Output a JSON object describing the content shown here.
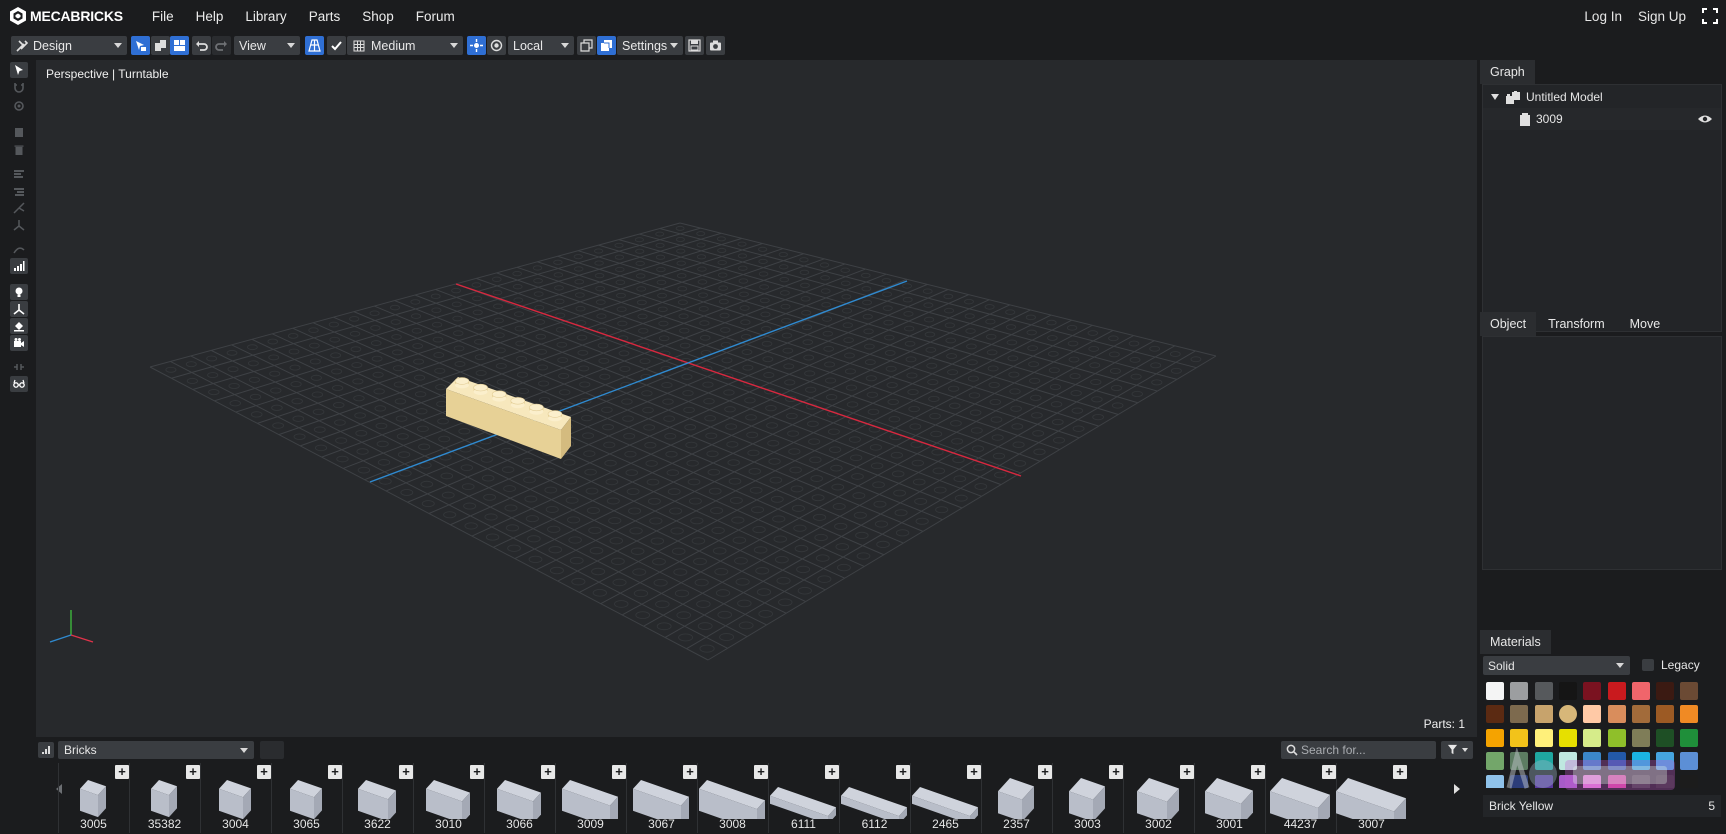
{
  "app": {
    "brand": "MECABRICKS"
  },
  "menu": [
    "File",
    "Help",
    "Library",
    "Parts",
    "Shop",
    "Forum"
  ],
  "auth": {
    "login": "Log In",
    "signup": "Sign Up"
  },
  "toolbar": {
    "mode": "Design",
    "view": "View",
    "quality": "Medium",
    "space": "Local",
    "settings": "Settings"
  },
  "viewport": {
    "label": "Perspective | Turntable",
    "parts_label": "Parts: 1"
  },
  "graph": {
    "tab": "Graph",
    "model_name": "Untitled Model",
    "part_id": "3009"
  },
  "object_tabs": [
    "Object",
    "Transform",
    "Move"
  ],
  "materials": {
    "tab": "Materials",
    "type": "Solid",
    "legacy_label": "Legacy",
    "selected_name": "Brick Yellow",
    "selected_code": "5",
    "swatches": [
      [
        "#f4f4f4",
        "#9c9ea0",
        "#56595c",
        "#151515",
        "#7a1220",
        "#c91a1e",
        "#f0656b",
        "#3b1a12",
        "#6b4a34"
      ],
      [
        "#5b2a12",
        "#7d6a4e",
        "#c7a36c",
        "#d7b779",
        "#ffc9a6",
        "#d98d5c",
        "#a26b3a",
        "#9c5a24",
        "#f08a24"
      ],
      [
        "#f5a300",
        "#f2c31a",
        "#fff07a",
        "#e6e000",
        "#d6ec8a",
        "#8fbf2a",
        "#7f7d58",
        "#1e4f25",
        "#1f8f3a"
      ],
      [
        "#73a66a",
        "#5c7c62",
        "#1fa7a0",
        "#bfe8e0",
        "#3b87c9",
        "#2359a8",
        "#1bb3e2",
        "#45a5e0",
        "#5c8fd6"
      ],
      [
        "#8fc2ea",
        "#2c3d7a",
        "#5a3a9e",
        "#a75bc9",
        "#e47ad6",
        "#d43f9a",
        "#3b3b3b",
        "#2a2a2a",
        "#1c1c1c"
      ]
    ]
  },
  "bricks": {
    "category": "Bricks",
    "search_placeholder": "Search for...",
    "items": [
      "3005",
      "35382",
      "3004",
      "3065",
      "3622",
      "3010",
      "3066",
      "3009",
      "3067",
      "3008",
      "6111",
      "6112",
      "2465",
      "2357",
      "3003",
      "3002",
      "3001",
      "44237",
      "3007"
    ]
  },
  "colors": {
    "accent_blue": "#2f6fd4",
    "axis_red": "#d7283f",
    "axis_blue": "#2f8ad0",
    "brick_yellow": "#efd9a0"
  }
}
